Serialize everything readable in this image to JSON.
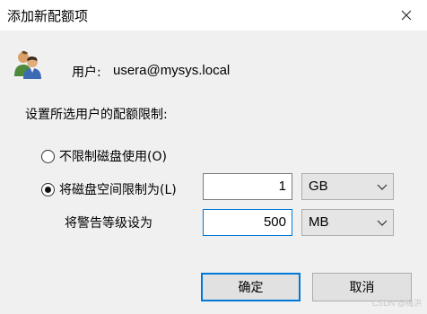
{
  "window": {
    "title": "添加新配额项",
    "close_icon": "close-icon"
  },
  "user": {
    "icon": "users-icon",
    "label": "用户:",
    "value": "usera@mysys.local"
  },
  "quota": {
    "section_label": "设置所选用户的配额限制:",
    "no_limit_label": "不限制磁盘使用(O)",
    "no_limit_selected": false,
    "limit_label": "将磁盘空间限制为(L)",
    "limit_selected": true,
    "limit_value": "1",
    "limit_unit": "GB",
    "warning_label": "将警告等级设为",
    "warning_value": "500",
    "warning_unit": "MB"
  },
  "buttons": {
    "ok_label": "确定",
    "cancel_label": "取消"
  },
  "watermark": "CSDN @梅洪"
}
